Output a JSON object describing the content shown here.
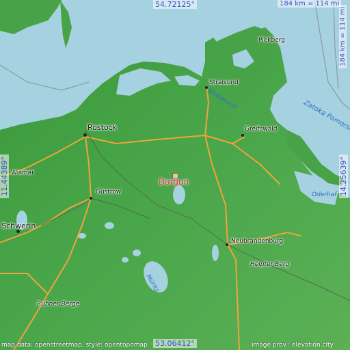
{
  "coords": {
    "north": "54.72125°",
    "south": "53.06412°",
    "west": "11.44389°",
    "east": "14.25639°"
  },
  "scale": {
    "horizontal": "184 km = 114 mi",
    "vertical": "184 km = 114 mi"
  },
  "highlight": {
    "name": "Dargun",
    "color": "#e8303a"
  },
  "cities": {
    "rostock": "Rostock",
    "stralsund": "Stralsund",
    "greifswald": "Greifswald",
    "pieskberg": "Piekberg",
    "guestrow": "Güstrow",
    "schwerin": "Schwerin",
    "wismar": "Wismar",
    "neubrandenburg": "Neubrandenburg",
    "helpter_berg": "Helpter Berg",
    "ruhner_berge": "Ruhner Berge"
  },
  "water_labels": {
    "zatoka": "Zatoka Pomorska",
    "strelasund": "Strelasund",
    "odershaff": "Oderhaf",
    "mueritz": "Müritz"
  },
  "footer": {
    "left": "map data: openstreetmap, style: opentopomap",
    "right": "image prov.: elevation.city"
  },
  "colors": {
    "sea": "#a6d1e0",
    "land": "#48a348",
    "road": "#f2a33a"
  }
}
